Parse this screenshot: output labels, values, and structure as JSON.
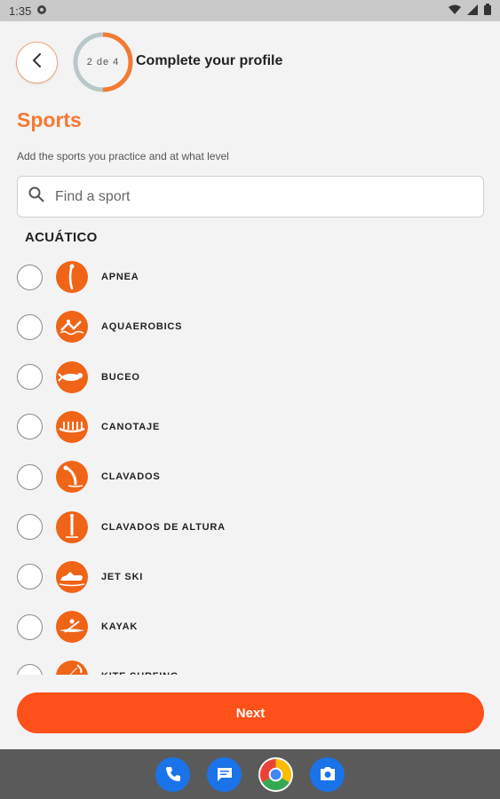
{
  "status_bar": {
    "time": "1:35"
  },
  "header": {
    "progress_text": "2 de 4",
    "progress_fraction": 0.5,
    "title": "Complete your profile"
  },
  "section": {
    "title": "Sports",
    "subtitle": "Add the sports you practice and at what level"
  },
  "search": {
    "placeholder": "Find a sport",
    "value": ""
  },
  "category": "ACUÁTICO",
  "sports": [
    {
      "label": "APNEA",
      "icon": "freediver-icon",
      "selected": false
    },
    {
      "label": "AQUAEROBICS",
      "icon": "aquaerobics-icon",
      "selected": false
    },
    {
      "label": "BUCEO",
      "icon": "scuba-diver-icon",
      "selected": false
    },
    {
      "label": "CANOTAJE",
      "icon": "rowing-icon",
      "selected": false
    },
    {
      "label": "CLAVADOS",
      "icon": "diving-icon",
      "selected": false
    },
    {
      "label": "CLAVADOS DE ALTURA",
      "icon": "high-diving-icon",
      "selected": false
    },
    {
      "label": "JET SKI",
      "icon": "jet-ski-icon",
      "selected": false
    },
    {
      "label": "KAYAK",
      "icon": "kayak-icon",
      "selected": false
    },
    {
      "label": "KITE SURFING",
      "icon": "kite-surfing-icon",
      "selected": false
    }
  ],
  "next_button": {
    "label": "Next"
  },
  "dock": [
    {
      "name": "phone-app-icon",
      "color": "#1a73e8"
    },
    {
      "name": "messages-app-icon",
      "color": "#1a73e8"
    },
    {
      "name": "chrome-app-icon",
      "color": "#ffffff"
    },
    {
      "name": "camera-app-icon",
      "color": "#1a73e8"
    }
  ],
  "colors": {
    "accent": "#f47a33",
    "icon_bg": "#f06418",
    "button": "#fe5019",
    "progress_track": "#b9c7c9"
  }
}
